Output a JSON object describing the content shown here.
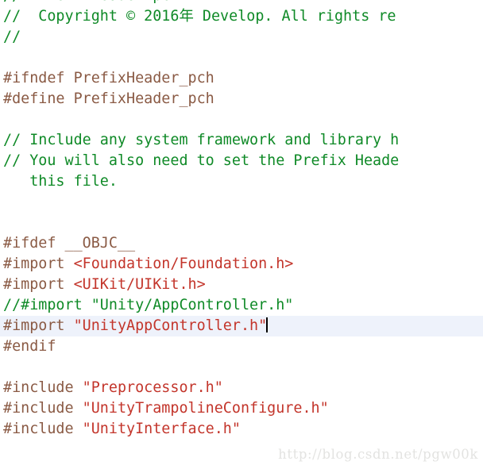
{
  "editor": {
    "background_color": "#ffffff",
    "current_line_highlight_color": "#eef2fb",
    "caret_color": "#000000",
    "syntax_colors": {
      "comment": "#0f8a27",
      "directive": "#8a5a44",
      "string": "#c3352b",
      "plain": "#3b3b3b"
    },
    "lines": [
      {
        "index": 0,
        "clipped_top": true,
        "current": false,
        "spans": [
          {
            "kind": "comment",
            "text": "//  PrefixHeader.pch"
          }
        ]
      },
      {
        "index": 1,
        "current": false,
        "spans": [
          {
            "kind": "comment",
            "text": "//  Copyright © 2016年 Develop. All rights re"
          }
        ]
      },
      {
        "index": 2,
        "current": false,
        "spans": [
          {
            "kind": "comment",
            "text": "//"
          }
        ]
      },
      {
        "index": 3,
        "current": false,
        "spans": []
      },
      {
        "index": 4,
        "current": false,
        "spans": [
          {
            "kind": "directive",
            "text": "#ifndef PrefixHeader_pch"
          }
        ]
      },
      {
        "index": 5,
        "current": false,
        "spans": [
          {
            "kind": "directive",
            "text": "#define PrefixHeader_pch"
          }
        ]
      },
      {
        "index": 6,
        "current": false,
        "spans": []
      },
      {
        "index": 7,
        "current": false,
        "spans": [
          {
            "kind": "comment",
            "text": "// Include any system framework and library h"
          }
        ]
      },
      {
        "index": 8,
        "current": false,
        "spans": [
          {
            "kind": "comment",
            "text": "// You will also need to set the Prefix Heade"
          }
        ]
      },
      {
        "index": 9,
        "current": false,
        "spans": [
          {
            "kind": "comment",
            "text": "   this file."
          }
        ]
      },
      {
        "index": 10,
        "current": false,
        "spans": []
      },
      {
        "index": 11,
        "current": false,
        "spans": []
      },
      {
        "index": 12,
        "current": false,
        "spans": [
          {
            "kind": "directive",
            "text": "#ifdef __OBJC__"
          }
        ]
      },
      {
        "index": 13,
        "current": false,
        "spans": [
          {
            "kind": "directive",
            "text": "#import "
          },
          {
            "kind": "string",
            "text": "<Foundation/Foundation.h>"
          }
        ]
      },
      {
        "index": 14,
        "current": false,
        "spans": [
          {
            "kind": "directive",
            "text": "#import "
          },
          {
            "kind": "string",
            "text": "<UIKit/UIKit.h>"
          }
        ]
      },
      {
        "index": 15,
        "current": false,
        "spans": [
          {
            "kind": "comment",
            "text": "//#import \"Unity/AppController.h\""
          }
        ]
      },
      {
        "index": 16,
        "current": true,
        "caret_after": true,
        "spans": [
          {
            "kind": "directive",
            "text": "#import "
          },
          {
            "kind": "string",
            "text": "\"UnityAppController.h\""
          }
        ]
      },
      {
        "index": 17,
        "current": false,
        "spans": [
          {
            "kind": "directive",
            "text": "#endif"
          }
        ]
      },
      {
        "index": 18,
        "current": false,
        "spans": []
      },
      {
        "index": 19,
        "current": false,
        "spans": [
          {
            "kind": "directive",
            "text": "#include "
          },
          {
            "kind": "string",
            "text": "\"Preprocessor.h\""
          }
        ]
      },
      {
        "index": 20,
        "current": false,
        "spans": [
          {
            "kind": "directive",
            "text": "#include "
          },
          {
            "kind": "string",
            "text": "\"UnityTrampolineConfigure.h\""
          }
        ]
      },
      {
        "index": 21,
        "current": false,
        "spans": [
          {
            "kind": "directive",
            "text": "#include "
          },
          {
            "kind": "string",
            "text": "\"UnityInterface.h\""
          }
        ]
      }
    ]
  },
  "watermark": {
    "text": "http://blog.csdn.net/pgw00k",
    "color": "#e3e3e1"
  }
}
